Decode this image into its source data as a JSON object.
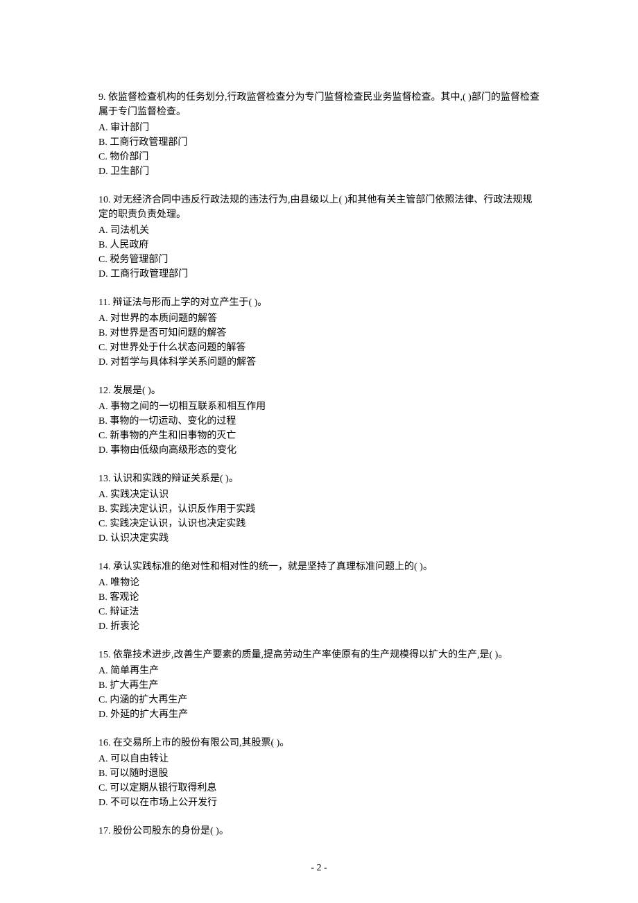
{
  "questions": [
    {
      "number": "9.",
      "text": "依监督检查机构的任务划分,行政监督检查分为专门监督检查民业务监督检查。其中,( )部门的监督检查属于专门监督检查。",
      "choices": [
        {
          "letter": "A.",
          "text": "审计部门"
        },
        {
          "letter": "B.",
          "text": "工商行政管理部门"
        },
        {
          "letter": "C.",
          "text": "物价部门"
        },
        {
          "letter": "D.",
          "text": "卫生部门"
        }
      ]
    },
    {
      "number": "10.",
      "text": "对无经济合同中违反行政法规的违法行为,由县级以上( )和其他有关主管部门依照法律、行政法规规定的职责负责处理。",
      "choices": [
        {
          "letter": "A.",
          "text": "司法机关"
        },
        {
          "letter": "B.",
          "text": "人民政府"
        },
        {
          "letter": "C.",
          "text": "税务管理部门"
        },
        {
          "letter": "D.",
          "text": "工商行政管理部门"
        }
      ]
    },
    {
      "number": "11.",
      "text": "辩证法与形而上学的对立产生于( )。",
      "choices": [
        {
          "letter": "A.",
          "text": "对世界的本质问题的解答"
        },
        {
          "letter": "B.",
          "text": "对世界是否可知问题的解答"
        },
        {
          "letter": "C.",
          "text": "对世界处于什么状态问题的解答"
        },
        {
          "letter": "D.",
          "text": "对哲学与具体科学关系问题的解答"
        }
      ]
    },
    {
      "number": "12.",
      "text": "发展是( )。",
      "choices": [
        {
          "letter": "A.",
          "text": "事物之间的一切相互联系和相互作用"
        },
        {
          "letter": "B.",
          "text": "事物的一切运动、变化的过程"
        },
        {
          "letter": "C.",
          "text": "新事物的产生和旧事物的灭亡"
        },
        {
          "letter": "D.",
          "text": "事物由低级向高级形态的变化"
        }
      ]
    },
    {
      "number": "13.",
      "text": "认识和实践的辩证关系是( )。",
      "choices": [
        {
          "letter": "A.",
          "text": "实践决定认识"
        },
        {
          "letter": "B.",
          "text": "实践决定认识，认识反作用于实践"
        },
        {
          "letter": "C.",
          "text": "实践决定认识，认识也决定实践"
        },
        {
          "letter": "D.",
          "text": "认识决定实践"
        }
      ]
    },
    {
      "number": "14.",
      "text": "承认实践标准的绝对性和相对性的统一，就是坚持了真理标准问题上的( )。",
      "choices": [
        {
          "letter": "A.",
          "text": "唯物论"
        },
        {
          "letter": "B.",
          "text": "客观论"
        },
        {
          "letter": "C.",
          "text": "辩证法"
        },
        {
          "letter": "D.",
          "text": "折衷论"
        }
      ]
    },
    {
      "number": "15.",
      "text": "依靠技术进步,改善生产要素的质量,提高劳动生产率使原有的生产规模得以扩大的生产,是( )。",
      "choices": [
        {
          "letter": "A.",
          "text": "简单再生产"
        },
        {
          "letter": "B.",
          "text": "扩大再生产"
        },
        {
          "letter": "C.",
          "text": "内涵的扩大再生产"
        },
        {
          "letter": "D.",
          "text": "外延的扩大再生产"
        }
      ]
    },
    {
      "number": "16.",
      "text": "在交易所上市的股份有限公司,其股票( )。",
      "choices": [
        {
          "letter": "A.",
          "text": "可以自由转让"
        },
        {
          "letter": "B.",
          "text": "可以随时退股"
        },
        {
          "letter": "C.",
          "text": "可以定期从银行取得利息"
        },
        {
          "letter": "D.",
          "text": "不可以在市场上公开发行"
        }
      ]
    },
    {
      "number": "17.",
      "text": "股份公司股东的身份是( )。",
      "choices": []
    }
  ],
  "page_number": "- 2 -"
}
